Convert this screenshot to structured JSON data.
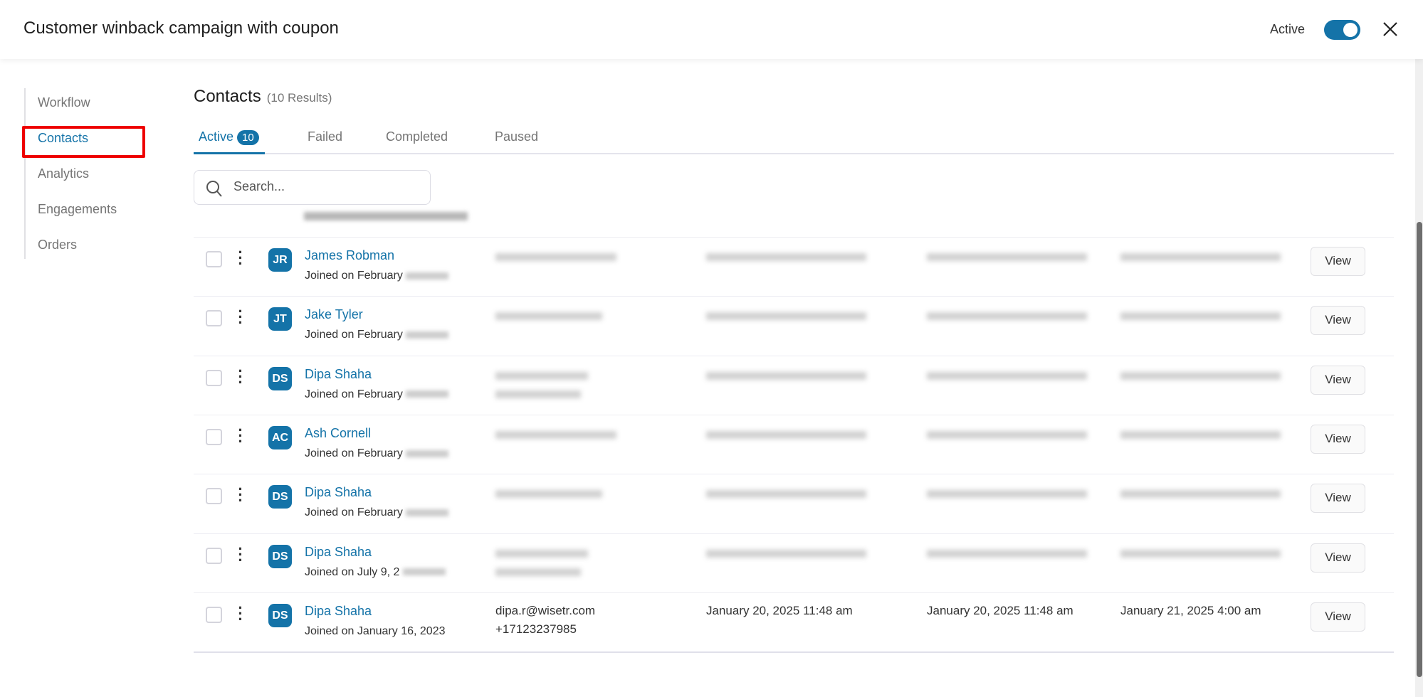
{
  "header": {
    "title": "Customer winback campaign with coupon",
    "status_label": "Active",
    "status_on": true
  },
  "sidebar": {
    "items": [
      {
        "label": "Workflow"
      },
      {
        "label": "Contacts",
        "active": true
      },
      {
        "label": "Analytics"
      },
      {
        "label": "Engagements"
      },
      {
        "label": "Orders"
      }
    ]
  },
  "main": {
    "title": "Contacts",
    "results": "(10 Results)",
    "tabs": [
      {
        "label": "Active",
        "count": "10"
      },
      {
        "label": "Failed"
      },
      {
        "label": "Completed"
      },
      {
        "label": "Paused"
      }
    ],
    "search_placeholder": "Search...",
    "view_label": "View",
    "rows": [
      {
        "initials": "JR",
        "name": "James Robman",
        "joined": "Joined on February"
      },
      {
        "initials": "JT",
        "name": "Jake Tyler",
        "joined": "Joined on February"
      },
      {
        "initials": "DS",
        "name": "Dipa Shaha",
        "joined": "Joined on February"
      },
      {
        "initials": "AC",
        "name": "Ash Cornell",
        "joined": "Joined on February"
      },
      {
        "initials": "DS",
        "name": "Dipa Shaha",
        "joined": "Joined on February"
      },
      {
        "initials": "DS",
        "name": "Dipa Shaha",
        "joined": "Joined on July 9, 2"
      },
      {
        "initials": "DS",
        "name": "Dipa Shaha",
        "joined": "Joined on January 16, 2023",
        "email": "dipa.r@wisetr.com",
        "phone": "+17123237985",
        "date1": "January 20, 2025 11:48 am",
        "date2": "January 20, 2025 11:48 am",
        "date3": "January 21, 2025 4:00 am"
      }
    ]
  },
  "colors": {
    "accent": "#1473a8",
    "highlight": "#ee0000"
  }
}
